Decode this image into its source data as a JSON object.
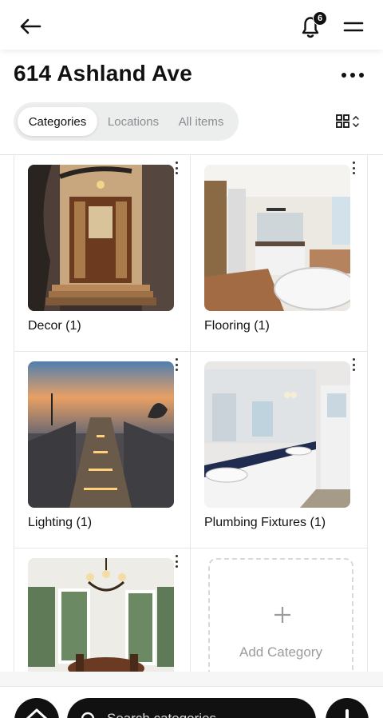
{
  "header": {
    "notification_count": "6",
    "title": "614 Ashland Ave"
  },
  "tabs": [
    {
      "label": "Categories",
      "active": true
    },
    {
      "label": "Locations",
      "active": false
    },
    {
      "label": "All items",
      "active": false
    }
  ],
  "categories": [
    {
      "label": "Decor (1)",
      "image": "front-door-entrance-photo"
    },
    {
      "label": "Flooring (1)",
      "image": "bathroom-tub-photo"
    },
    {
      "label": "Lighting (1)",
      "image": "lit-outdoor-stairs-photo"
    },
    {
      "label": "Plumbing Fixtures (1)",
      "image": "bathroom-vanity-photo"
    },
    {
      "label": "",
      "image": "dining-room-chandelier-photo"
    }
  ],
  "add_category": {
    "label": "Add Category"
  },
  "search": {
    "placeholder": "Search categories"
  },
  "icons": [
    "back-arrow-icon",
    "bell-icon",
    "hamburger-menu-icon",
    "more-horizontal-icon",
    "grid-view-icon",
    "sort-chevrons-icon",
    "kebab-icon",
    "plus-icon",
    "home-icon",
    "search-icon"
  ],
  "colors": {
    "primary": "#111111",
    "segment_bg": "#eceded",
    "muted_text": "#8a8d91",
    "dashed_border": "#d9d9d9"
  }
}
